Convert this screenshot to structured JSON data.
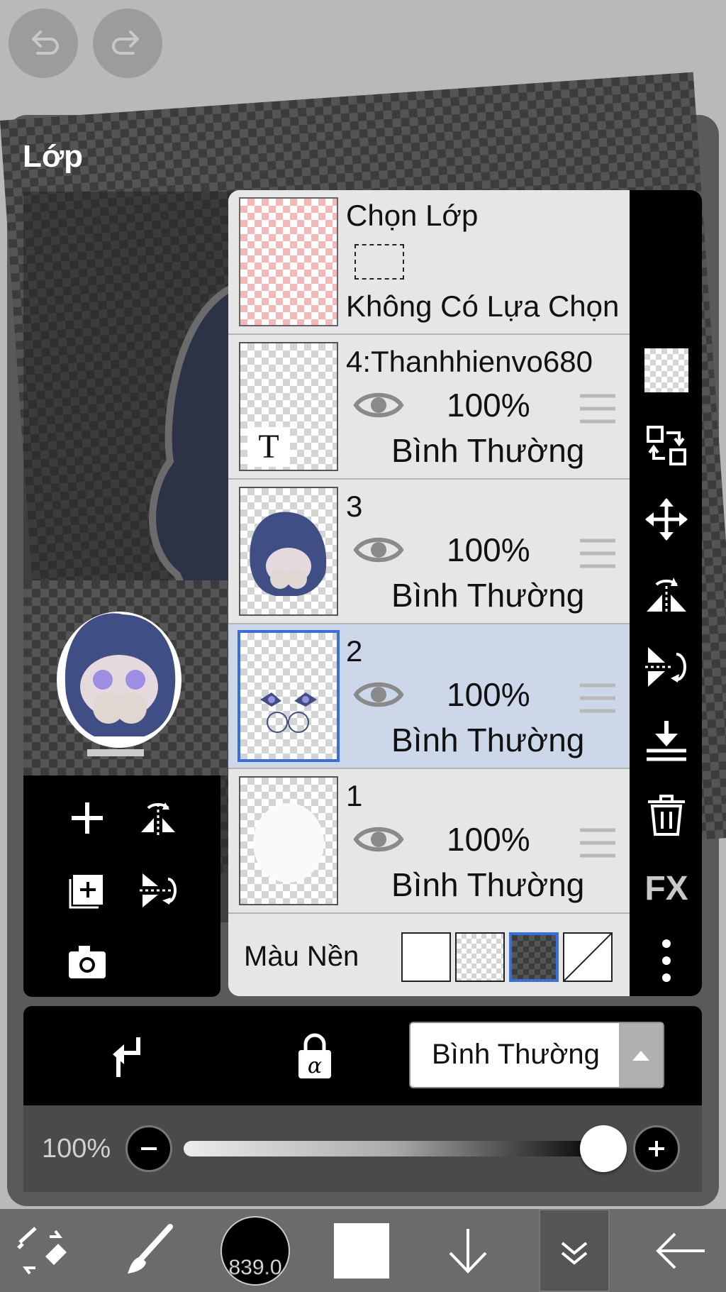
{
  "header": {
    "undo_icon": "undo-icon",
    "redo_icon": "redo-icon"
  },
  "panel": {
    "title": "Lớp"
  },
  "selection_layer": {
    "title": "Chọn Lớp",
    "status": "Không Có Lựa Chọn"
  },
  "layers": [
    {
      "name": "4:Thanhhienvo680",
      "opacity": "100%",
      "blend": "Bình Thường",
      "visible": true,
      "selected": false
    },
    {
      "name": "3",
      "opacity": "100%",
      "blend": "Bình Thường",
      "visible": true,
      "selected": false
    },
    {
      "name": "2",
      "opacity": "100%",
      "blend": "Bình Thường",
      "visible": true,
      "selected": true
    },
    {
      "name": "1",
      "opacity": "100%",
      "blend": "Bình Thường",
      "visible": true,
      "selected": false
    }
  ],
  "background": {
    "label": "Màu Nền",
    "options": [
      "white",
      "checker",
      "dark-checker",
      "none"
    ],
    "selected": "dark-checker"
  },
  "side_tools": {
    "fx_label": "FX",
    "icons": [
      "checker-icon",
      "transfer-icon",
      "move-icon",
      "flip-horizontal-icon",
      "flip-vertical-icon",
      "merge-down-icon",
      "trash-icon",
      "fx-icon",
      "more-icon"
    ]
  },
  "left_tools": [
    "add-layer-icon",
    "flip-layer-horizontal-icon",
    "add-copy-layer-icon",
    "flip-layer-vertical-icon",
    "camera-icon"
  ],
  "blend_bar": {
    "clip_icon": "clipping-icon",
    "alpha_lock_icon": "alpha-lock-icon",
    "mode": "Bình Thường"
  },
  "opacity_bar": {
    "value": "100%",
    "fraction": 1.0
  },
  "toolbar": {
    "brush_size": "839.0",
    "color": "#000000",
    "secondary_color": "#ffffff"
  },
  "colors": {
    "accent": "#3a6fd8",
    "selected_row": "#cdd7ea",
    "panel_bg": "#e6e6e6"
  }
}
